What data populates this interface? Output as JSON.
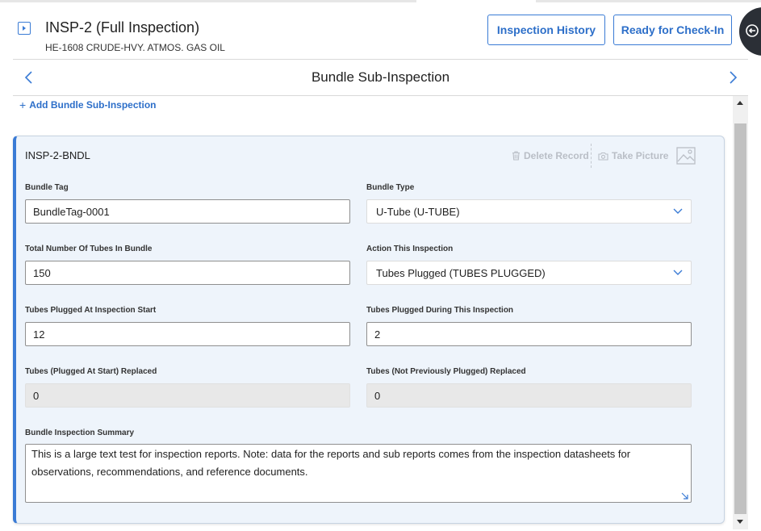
{
  "header": {
    "title": "INSP-2 (Full Inspection)",
    "subtitle": "HE-1608 CRUDE-HVY. ATMOS. GAS OIL",
    "inspection_history_label": "Inspection History",
    "ready_for_checkin_label": "Ready for Check-In"
  },
  "nav": {
    "title": "Bundle Sub-Inspection"
  },
  "add_link": "Add Bundle Sub-Inspection",
  "card": {
    "title": "INSP-2-BNDL",
    "delete_label": "Delete Record",
    "take_picture_label": "Take Picture"
  },
  "fields": {
    "bundle_tag": {
      "label": "Bundle Tag",
      "value": "BundleTag-0001"
    },
    "bundle_type": {
      "label": "Bundle Type",
      "value": "U-Tube (U-TUBE)"
    },
    "total_tubes": {
      "label": "Total Number Of Tubes In Bundle",
      "value": "150"
    },
    "action": {
      "label": "Action This Inspection",
      "value": "Tubes Plugged (TUBES PLUGGED)"
    },
    "plugged_start": {
      "label": "Tubes Plugged At Inspection Start",
      "value": "12"
    },
    "plugged_during": {
      "label": "Tubes Plugged During This Inspection",
      "value": "2"
    },
    "replaced_start": {
      "label": "Tubes (Plugged At Start) Replaced",
      "value": "0"
    },
    "replaced_not_prev": {
      "label": "Tubes (Not Previously Plugged) Replaced",
      "value": "0"
    },
    "summary": {
      "label": "Bundle Inspection Summary",
      "value": "This is a large text test for inspection reports. Note: data for the reports and sub reports comes from the inspection datasheets for observations, recommendations, and reference documents."
    }
  },
  "colors": {
    "accent": "#3a7bd5",
    "card_bg": "#eef4fb",
    "readonly_bg": "#e8e8e8"
  }
}
